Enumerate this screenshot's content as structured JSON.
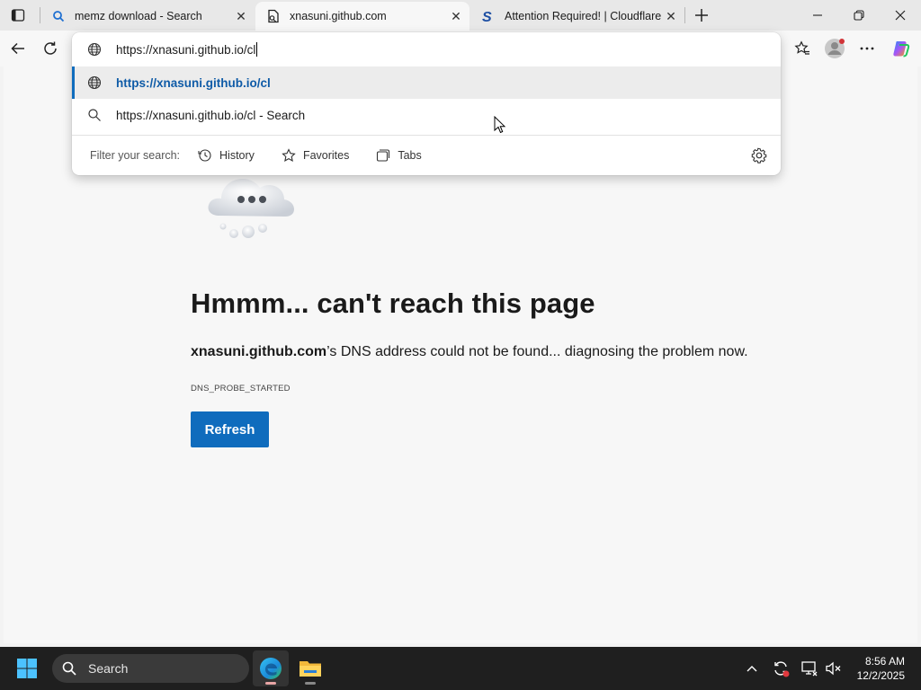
{
  "tabs": [
    {
      "title": "memz download - Search",
      "active": false
    },
    {
      "title": "xnasuni.github.com",
      "active": true
    },
    {
      "title": "Attention Required! | Cloudflare",
      "active": false
    }
  ],
  "omnibox": {
    "input_value": "https://xnasuni.github.io/cl",
    "suggestions": [
      {
        "text": "https://xnasuni.github.io/cl",
        "icon": "globe-icon",
        "selected": true
      },
      {
        "text": "https://xnasuni.github.io/cl - Search",
        "icon": "search-icon",
        "selected": false
      }
    ],
    "filter_label": "Filter your search:",
    "filters": [
      {
        "label": "History",
        "icon": "history-icon"
      },
      {
        "label": "Favorites",
        "icon": "star-icon"
      },
      {
        "label": "Tabs",
        "icon": "tabs-icon"
      }
    ]
  },
  "error_page": {
    "heading": "Hmmm... can't reach this page",
    "host": "xnasuni.github.com",
    "message_rest": "’s DNS address could not be found... diagnosing the problem now.",
    "error_code": "DNS_PROBE_STARTED",
    "refresh_label": "Refresh"
  },
  "taskbar": {
    "search_label": "Search",
    "time": "8:56 AM",
    "date": "12/2/2025"
  },
  "colors": {
    "accent": "#0f6cbd",
    "taskbar": "#1f1f1f",
    "selected_suggestion_text": "#0f5ba7"
  }
}
